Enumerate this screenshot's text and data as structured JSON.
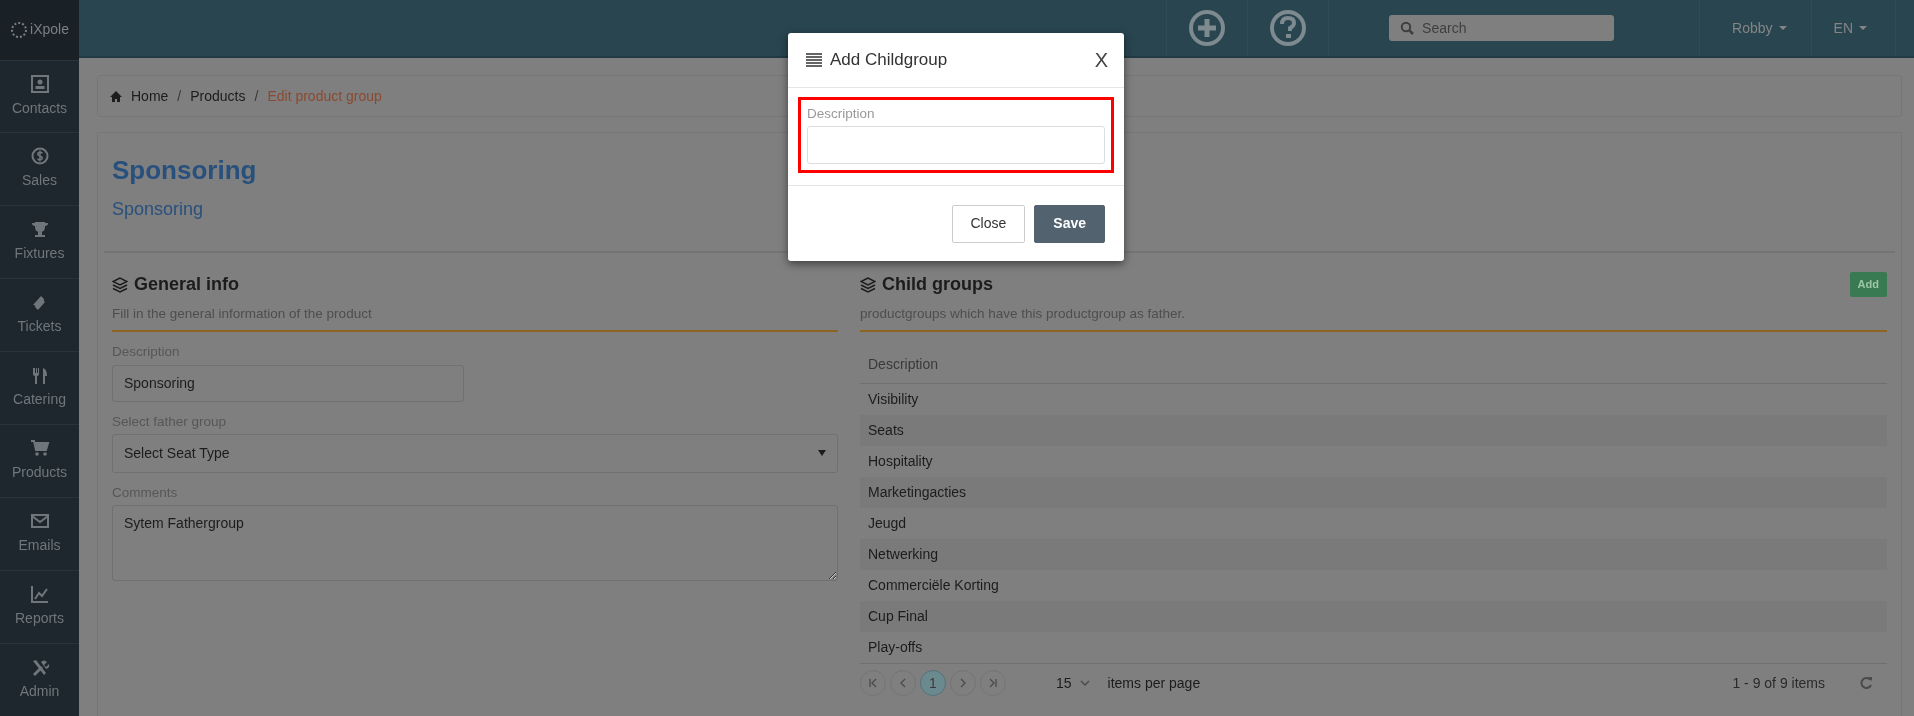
{
  "logo": {
    "text": "iXpole"
  },
  "sidebar": {
    "items": [
      {
        "label": "Contacts"
      },
      {
        "label": "Sales"
      },
      {
        "label": "Fixtures"
      },
      {
        "label": "Tickets"
      },
      {
        "label": "Catering"
      },
      {
        "label": "Products"
      },
      {
        "label": "Emails"
      },
      {
        "label": "Reports"
      },
      {
        "label": "Admin"
      }
    ]
  },
  "topbar": {
    "search": {
      "placeholder": "Search"
    },
    "user": "Robby",
    "language": "EN"
  },
  "breadcrumb": [
    {
      "label": "Home",
      "current": false
    },
    {
      "label": "Products",
      "current": false,
      "separator": "/"
    },
    {
      "label": "Edit product group",
      "current": true,
      "separator": "/"
    }
  ],
  "page": {
    "title": "Sponsoring",
    "subtitle": "Sponsoring"
  },
  "general_info": {
    "title": "General info",
    "subtitle": "Fill in the general information of the product",
    "fields": [
      {
        "kind": "input",
        "label": "Description",
        "value": "Sponsoring"
      },
      {
        "kind": "select",
        "label": "Select father group",
        "value": "Select Seat Type"
      },
      {
        "kind": "textarea",
        "label": "Comments",
        "value": "Sytem Fathergroup"
      }
    ]
  },
  "child_groups": {
    "title": "Child groups",
    "subtitle": "productgroups which have this productgroup as father.",
    "add_button": "Add",
    "columns": [
      "Description"
    ],
    "rows": [
      "Visibility",
      "Seats",
      "Hospitality",
      "Marketingacties",
      "Jeugd",
      "Netwerking",
      "Commerciële Korting",
      "Cup Final",
      "Play-offs"
    ],
    "pager": {
      "pages": [
        {
          "label": "1",
          "selected": true
        }
      ],
      "page_size": "15",
      "page_size_label": "items per page",
      "summary": "1 - 9 of 9 items"
    }
  },
  "modal": {
    "title": "Add Childgroup",
    "close": "X",
    "field": {
      "label": "Description",
      "highlighted": true
    },
    "buttons": [
      {
        "label": "Close",
        "kind": "secondary"
      },
      {
        "label": "Save",
        "kind": "primary"
      }
    ]
  }
}
